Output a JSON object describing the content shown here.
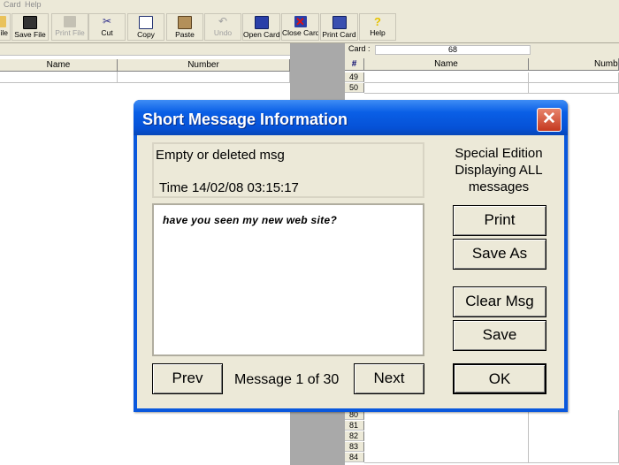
{
  "menu": [
    "Card",
    "Help"
  ],
  "toolbar": [
    {
      "label": "File",
      "disabled": false
    },
    {
      "label": "Save File",
      "disabled": false
    },
    {
      "label": "Print File",
      "disabled": true
    },
    {
      "label": "Cut",
      "disabled": false
    },
    {
      "label": "Copy",
      "disabled": false
    },
    {
      "label": "Paste",
      "disabled": false
    },
    {
      "label": "Undo",
      "disabled": true
    },
    {
      "label": "Open Card",
      "disabled": false
    },
    {
      "label": "Close Card",
      "disabled": false
    },
    {
      "label": "Print Card",
      "disabled": false
    },
    {
      "label": "Help",
      "disabled": false
    }
  ],
  "left_table": {
    "headers": [
      "Name",
      "Number"
    ]
  },
  "card": {
    "label": "Card :",
    "value": "68"
  },
  "right_table": {
    "headers": [
      "#",
      "Name",
      "Numb"
    ],
    "rows_top": [
      "49",
      "50"
    ],
    "rows_bottom": [
      "80",
      "81",
      "82",
      "83",
      "84"
    ]
  },
  "dialog": {
    "title": "Short Message Information",
    "status": "Empty or deleted msg",
    "time": "Time 14/02/08 03:15:17",
    "message_text": "have you seen my new web site?",
    "special_edition": [
      "Special Edition",
      "Displaying ALL",
      "messages"
    ],
    "buttons": {
      "print": "Print",
      "save_as": "Save As",
      "clear_msg": "Clear Msg",
      "save": "Save",
      "prev": "Prev",
      "next": "Next",
      "ok": "OK"
    },
    "message_counter": "Message 1 of 30"
  },
  "colors": {
    "title_blue": "#0a58dd",
    "close_red": "#d4543a",
    "window_face": "#ece9d8"
  },
  "icons": {
    "close": "close-icon"
  }
}
